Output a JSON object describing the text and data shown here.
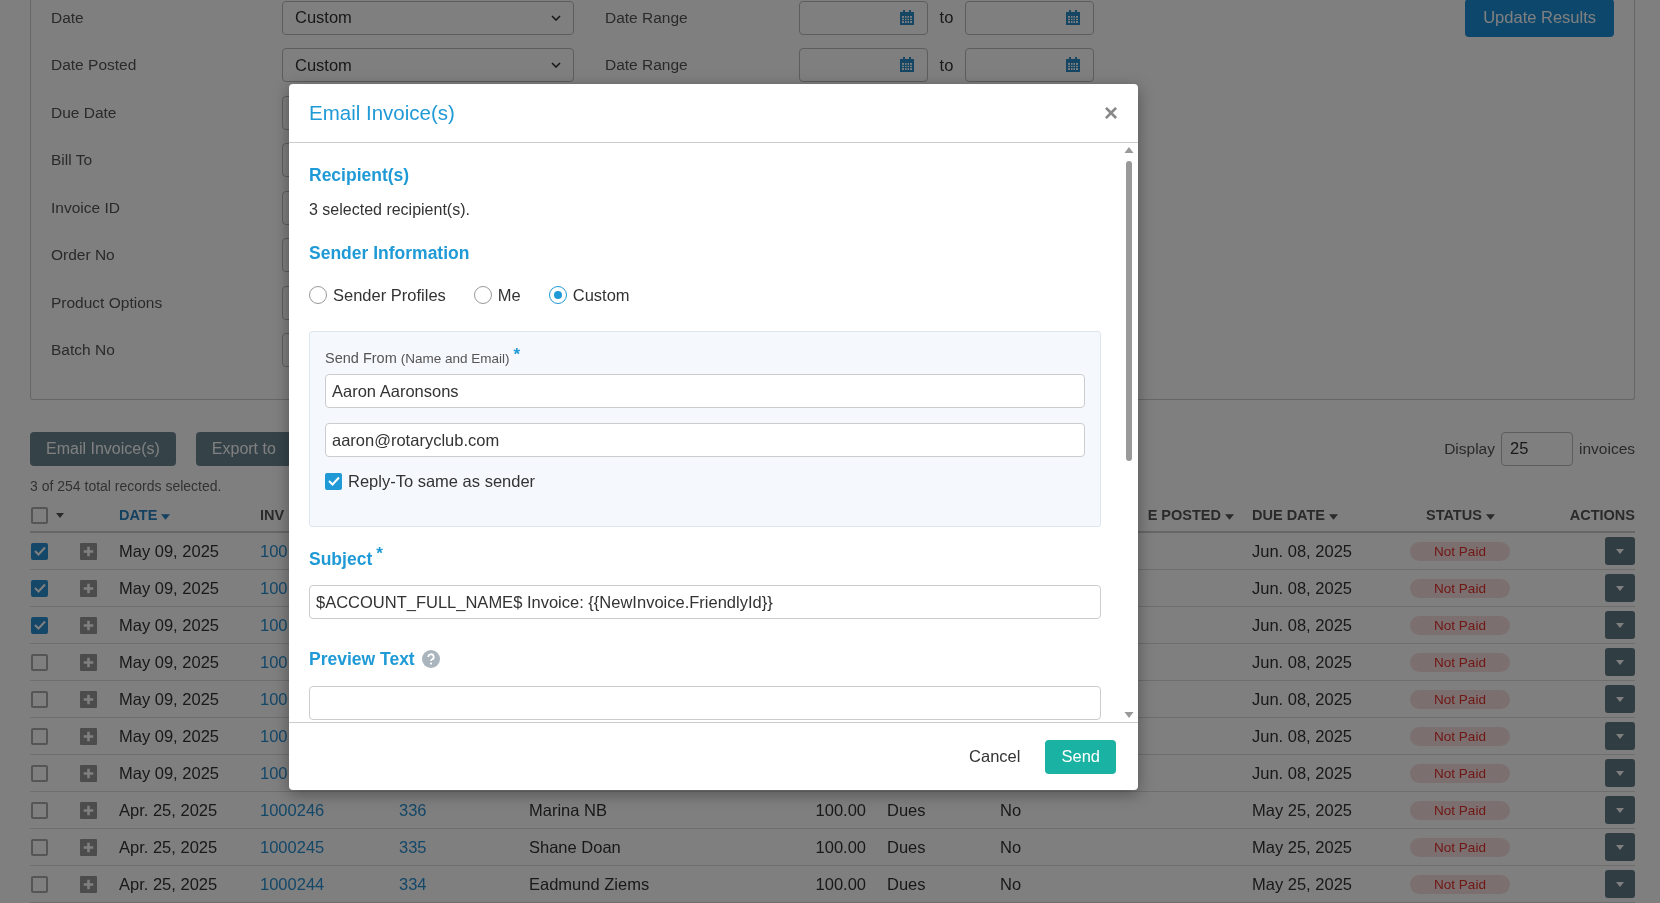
{
  "filters": [
    {
      "label": "Date",
      "value": "Custom",
      "range_label": "Date Range",
      "to": "to"
    },
    {
      "label": "Date Posted",
      "value": "Custom",
      "range_label": "Date Range",
      "to": "to"
    },
    {
      "label": "Due Date"
    },
    {
      "label": "Bill To"
    },
    {
      "label": "Invoice ID"
    },
    {
      "label": "Order No"
    },
    {
      "label": "Product Options"
    },
    {
      "label": "Batch No"
    }
  ],
  "update_button": "Update Results",
  "toolbar": {
    "buttons": [
      "Email Invoice(s)",
      "Export to"
    ],
    "display_label": "Display",
    "display_value": "25",
    "display_suffix": "invoices"
  },
  "selection_summary": "3 of 254 total records selected.",
  "table": {
    "select_all_checked": false,
    "columns": {
      "date": {
        "label": "DATE",
        "sort_caret": true
      },
      "invoice": {
        "label": "INV"
      },
      "date_posted": {
        "label": "E POSTED",
        "sort_caret": true
      },
      "due_date": {
        "label": "DUE DATE",
        "sort_caret": true
      },
      "status": {
        "label": "STATUS",
        "sort_caret": true
      },
      "actions": {
        "label": "ACTIONS"
      }
    },
    "rows": [
      {
        "checked": true,
        "date": "May 09, 2025",
        "invoice": "100",
        "due_date": "Jun. 08, 2025",
        "status": "Not Paid"
      },
      {
        "checked": true,
        "date": "May 09, 2025",
        "invoice": "100",
        "due_date": "Jun. 08, 2025",
        "status": "Not Paid"
      },
      {
        "checked": true,
        "date": "May 09, 2025",
        "invoice": "100",
        "due_date": "Jun. 08, 2025",
        "status": "Not Paid"
      },
      {
        "checked": false,
        "date": "May 09, 2025",
        "invoice": "100",
        "due_date": "Jun. 08, 2025",
        "status": "Not Paid"
      },
      {
        "checked": false,
        "date": "May 09, 2025",
        "invoice": "100",
        "due_date": "Jun. 08, 2025",
        "status": "Not Paid"
      },
      {
        "checked": false,
        "date": "May 09, 2025",
        "invoice": "100",
        "due_date": "Jun. 08, 2025",
        "status": "Not Paid"
      },
      {
        "checked": false,
        "date": "May 09, 2025",
        "invoice": "100",
        "due_date": "Jun. 08, 2025",
        "status": "Not Paid"
      },
      {
        "checked": false,
        "date": "Apr. 25, 2025",
        "invoice": "1000246",
        "order_no": "336",
        "bill_to": "Marina NB",
        "amount": "100.00",
        "type": "Dues",
        "column_8": "No",
        "due_date": "May 25, 2025",
        "status": "Not Paid"
      },
      {
        "checked": false,
        "date": "Apr. 25, 2025",
        "invoice": "1000245",
        "order_no": "335",
        "bill_to": "Shane Doan",
        "amount": "100.00",
        "type": "Dues",
        "column_8": "No",
        "due_date": "May 25, 2025",
        "status": "Not Paid"
      },
      {
        "checked": false,
        "date": "Apr. 25, 2025",
        "invoice": "1000244",
        "order_no": "334",
        "bill_to": "Eadmund Ziems",
        "amount": "100.00",
        "type": "Dues",
        "column_8": "No",
        "due_date": "May 25, 2025",
        "status": "Not Paid"
      }
    ]
  },
  "modal": {
    "title": "Email Invoice(s)",
    "close": "×",
    "recipients": {
      "heading": "Recipient(s)",
      "text": "3 selected recipient(s)."
    },
    "sender": {
      "heading": "Sender Information",
      "options": [
        {
          "label": "Sender Profiles",
          "selected": false
        },
        {
          "label": "Me",
          "selected": false
        },
        {
          "label": "Custom",
          "selected": true
        }
      ],
      "panel": {
        "label": "Send From",
        "hint": "(Name and Email)",
        "required_mark": "*",
        "name_value": "Aaron Aaronsons",
        "email_value": "aaron@rotaryclub.com",
        "reply_to": {
          "label": "Reply-To same as sender",
          "checked": true
        }
      }
    },
    "subject": {
      "label": "Subject",
      "required_mark": "*",
      "value": "$ACCOUNT_FULL_NAME$ Invoice: {{NewInvoice.FriendlyId}}"
    },
    "preview": {
      "label": "Preview Text"
    },
    "cancel": "Cancel",
    "send": "Send"
  }
}
